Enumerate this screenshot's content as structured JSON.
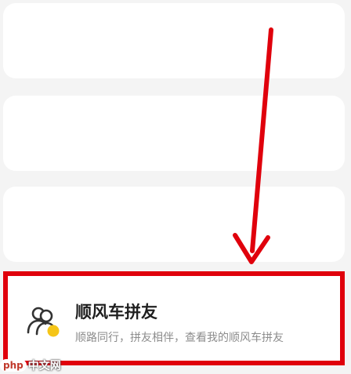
{
  "ride_share_item": {
    "title": "顺风车拼友",
    "subtitle": "顺路同行，拼友相伴，查看我的顺风车拼友",
    "icon": "people-icon"
  },
  "watermark": {
    "logo_text": "php",
    "site_text": "中文网"
  },
  "colors": {
    "highlight_border": "#e0000c",
    "arrow": "#e0000c",
    "icon_accent": "#f5c518"
  }
}
